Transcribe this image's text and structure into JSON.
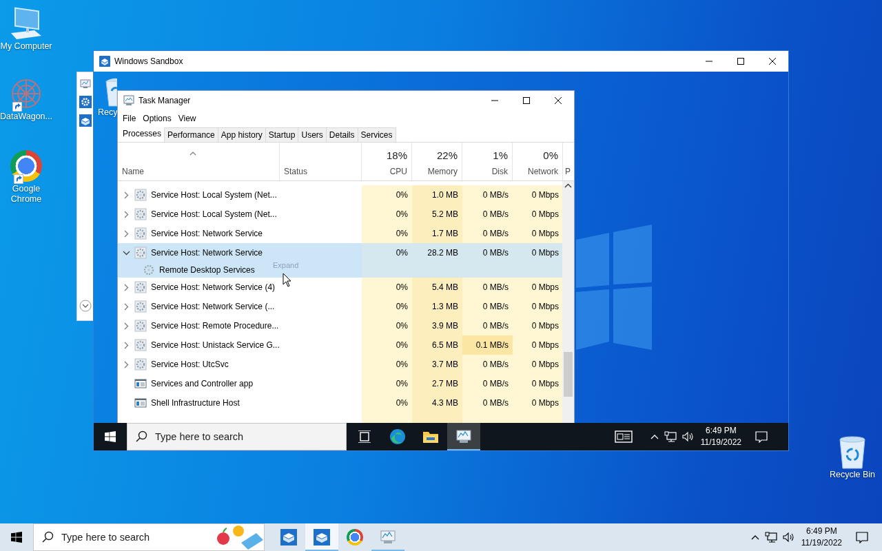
{
  "desktop": {
    "icons": [
      {
        "label": "My Computer",
        "kind": "computer",
        "shortcut": false
      },
      {
        "label": "DataWagon...",
        "kind": "datawagon",
        "shortcut": true
      },
      {
        "label": "Google Chrome",
        "kind": "chrome",
        "shortcut": true
      },
      {
        "label": "Recycle Bin",
        "kind": "recycle",
        "shortcut": false
      }
    ]
  },
  "sandbox_window": {
    "title": "Windows Sandbox",
    "desktop_icons": [
      {
        "label": "Recy",
        "kind": "recycle"
      }
    ],
    "task_manager": {
      "title": "Task Manager",
      "menu": [
        "File",
        "Options",
        "View"
      ],
      "tabs": [
        {
          "label": "Processes",
          "selected": true
        },
        {
          "label": "Performance",
          "selected": false
        },
        {
          "label": "App history",
          "selected": false
        },
        {
          "label": "Startup",
          "selected": false
        },
        {
          "label": "Users",
          "selected": false
        },
        {
          "label": "Details",
          "selected": false
        },
        {
          "label": "Services",
          "selected": false
        }
      ],
      "columns": [
        {
          "label": "Name",
          "sorted": true
        },
        {
          "label": "Status",
          "sorted": false
        },
        {
          "label": "CPU",
          "usage": "18%",
          "sorted": false
        },
        {
          "label": "Memory",
          "usage": "22%",
          "sorted": false
        },
        {
          "label": "Disk",
          "usage": "1%",
          "sorted": false
        },
        {
          "label": "Network",
          "usage": "0%",
          "sorted": false
        },
        {
          "label": "P",
          "sorted": false
        }
      ],
      "rows": [
        {
          "kind": "group",
          "name": "Service Host: Local System (Net...",
          "expanded": false,
          "selected": false,
          "cpu": "0%",
          "memory": "1.0 MB",
          "disk": "0 MB/s",
          "network": "0 Mbps"
        },
        {
          "kind": "group",
          "name": "Service Host: Local System (Net...",
          "expanded": false,
          "selected": false,
          "cpu": "0%",
          "memory": "5.2 MB",
          "disk": "0 MB/s",
          "network": "0 Mbps"
        },
        {
          "kind": "group",
          "name": "Service Host: Network Service",
          "expanded": false,
          "selected": false,
          "cpu": "0%",
          "memory": "1.7 MB",
          "disk": "0 MB/s",
          "network": "0 Mbps"
        },
        {
          "kind": "group",
          "name": "Service Host: Network Service",
          "expanded": true,
          "selected": true,
          "cpu": "0%",
          "memory": "28.2 MB",
          "disk": "0 MB/s",
          "network": "0 Mbps"
        },
        {
          "kind": "service",
          "name": "Remote Desktop Services",
          "selected": true
        },
        {
          "kind": "group",
          "name": "Service Host: Network Service (4)",
          "expanded": false,
          "selected": false,
          "cpu": "0%",
          "memory": "5.4 MB",
          "disk": "0 MB/s",
          "network": "0 Mbps"
        },
        {
          "kind": "group",
          "name": "Service Host: Network Service (...",
          "expanded": false,
          "selected": false,
          "cpu": "0%",
          "memory": "1.3 MB",
          "disk": "0 MB/s",
          "network": "0 Mbps"
        },
        {
          "kind": "group",
          "name": "Service Host: Remote Procedure...",
          "expanded": false,
          "selected": false,
          "cpu": "0%",
          "memory": "3.9 MB",
          "disk": "0 MB/s",
          "network": "0 Mbps"
        },
        {
          "kind": "group",
          "name": "Service Host: Unistack Service G...",
          "expanded": false,
          "selected": false,
          "cpu": "0%",
          "memory": "6.5 MB",
          "disk": "0.1 MB/s",
          "network": "0 Mbps"
        },
        {
          "kind": "group",
          "name": "Service Host: UtcSvc",
          "expanded": false,
          "selected": false,
          "cpu": "0%",
          "memory": "3.7 MB",
          "disk": "0 MB/s",
          "network": "0 Mbps"
        },
        {
          "kind": "app",
          "name": "Services and Controller app",
          "selected": false,
          "cpu": "0%",
          "memory": "2.7 MB",
          "disk": "0 MB/s",
          "network": "0 Mbps"
        },
        {
          "kind": "app",
          "name": "Shell Infrastructure Host",
          "selected": false,
          "cpu": "0%",
          "memory": "4.3 MB",
          "disk": "0 MB/s",
          "network": "0 Mbps"
        }
      ],
      "tooltip": "Expand"
    },
    "taskbar": {
      "search_placeholder": "Type here to search",
      "search_highlight": false,
      "news": true,
      "apps": [
        {
          "kind": "taskview",
          "active": false,
          "running": false
        },
        {
          "kind": "edge",
          "active": false,
          "running": false
        },
        {
          "kind": "explorer",
          "active": false,
          "running": false
        },
        {
          "kind": "taskmanager",
          "active": true,
          "running": true
        }
      ],
      "time": "6:49 PM",
      "date": "11/19/2022"
    }
  },
  "taskbar": {
    "search_placeholder": "Type here to search",
    "search_highlight": true,
    "news": false,
    "apps": [
      {
        "kind": "sandbox",
        "active": false,
        "running": false
      },
      {
        "kind": "sandbox",
        "active": true,
        "running": true
      },
      {
        "kind": "chrome",
        "active": false,
        "running": false
      },
      {
        "kind": "taskmanager",
        "active": false,
        "running": true
      }
    ],
    "time": "6:49 PM",
    "date": "11/19/2022"
  }
}
